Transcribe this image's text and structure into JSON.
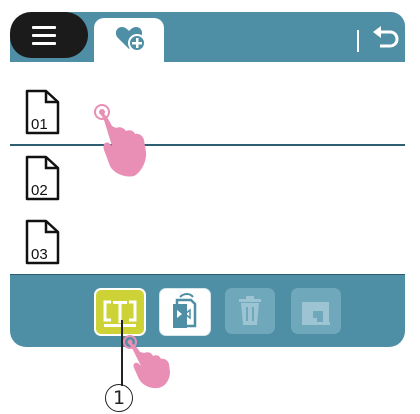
{
  "header": {
    "menu_icon": "menu-icon",
    "active_tab_icon": "heart-plus-icon",
    "back_icon": "back-arrow-icon"
  },
  "files": [
    {
      "label": "01",
      "icon": "document-icon"
    },
    {
      "label": "02",
      "icon": "document-icon"
    },
    {
      "label": "03",
      "icon": "document-icon"
    }
  ],
  "toolbar": {
    "text_edit_icon": "text-edit-icon",
    "flip_icon": "flip-icon",
    "delete_icon": "trash-icon",
    "sew_icon": "sewing-machine-icon"
  },
  "callout": {
    "number": "1"
  },
  "colors": {
    "bar": "#4f8fa6",
    "menu": "#1b1b1b",
    "highlight": "#cdd236",
    "divider": "#2d5e72",
    "touch_hand": "#e98fb5"
  }
}
